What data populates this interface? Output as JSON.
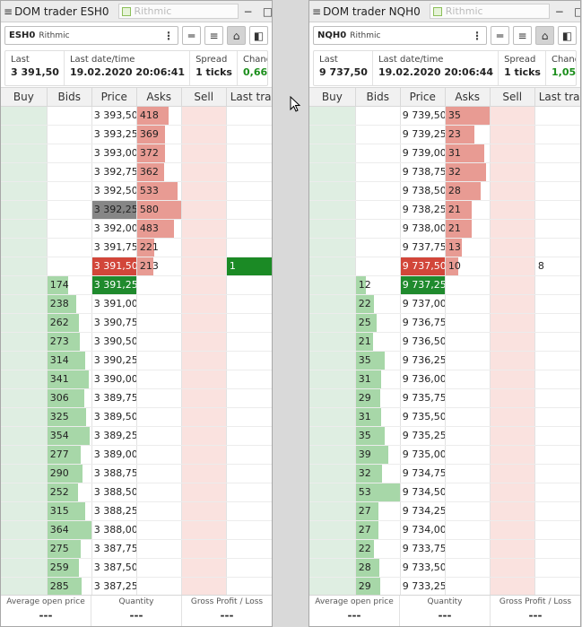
{
  "windows": [
    {
      "title": "DOM trader ESH0",
      "tab_label": "Rithmic",
      "symbol": "ESH0",
      "connection": "Rithmic",
      "info": [
        {
          "label": "Last",
          "value": "3 391,50"
        },
        {
          "label": "Last date/time",
          "value": "19.02.2020 20:06:41"
        },
        {
          "label": "Spread",
          "value": "1 ticks"
        },
        {
          "label": "Change, %",
          "value": "0,66"
        }
      ],
      "headers": [
        "Buy",
        "Bids",
        "Price",
        "Asks",
        "Sell",
        "Last trade"
      ],
      "rows": [
        {
          "price": "3 393,50",
          "ask": "418",
          "askv": 418
        },
        {
          "price": "3 393,25",
          "ask": "369",
          "askv": 369
        },
        {
          "price": "3 393,00",
          "ask": "372",
          "askv": 372
        },
        {
          "price": "3 392,75",
          "ask": "362",
          "askv": 362
        },
        {
          "price": "3 392,50",
          "ask": "533",
          "askv": 533
        },
        {
          "price": "3 392,25",
          "ask": "580",
          "askv": 580,
          "sel": true
        },
        {
          "price": "3 392,00",
          "ask": "483",
          "askv": 483
        },
        {
          "price": "3 391,75",
          "ask": "221",
          "askv": 221
        },
        {
          "price": "3 391,50",
          "ask": "213",
          "askv": 213,
          "best": "ask",
          "last": "1"
        },
        {
          "price": "3 391,25",
          "bid": "174",
          "bidv": 174,
          "best": "bid"
        },
        {
          "price": "3 391,00",
          "bid": "238",
          "bidv": 238
        },
        {
          "price": "3 390,75",
          "bid": "262",
          "bidv": 262
        },
        {
          "price": "3 390,50",
          "bid": "273",
          "bidv": 273
        },
        {
          "price": "3 390,25",
          "bid": "314",
          "bidv": 314
        },
        {
          "price": "3 390,00",
          "bid": "341",
          "bidv": 341
        },
        {
          "price": "3 389,75",
          "bid": "306",
          "bidv": 306
        },
        {
          "price": "3 389,50",
          "bid": "325",
          "bidv": 325
        },
        {
          "price": "3 389,25",
          "bid": "354",
          "bidv": 354
        },
        {
          "price": "3 389,00",
          "bid": "277",
          "bidv": 277
        },
        {
          "price": "3 388,75",
          "bid": "290",
          "bidv": 290
        },
        {
          "price": "3 388,50",
          "bid": "252",
          "bidv": 252
        },
        {
          "price": "3 388,25",
          "bid": "315",
          "bidv": 315
        },
        {
          "price": "3 388,00",
          "bid": "364",
          "bidv": 364
        },
        {
          "price": "3 387,75",
          "bid": "275",
          "bidv": 275
        },
        {
          "price": "3 387,50",
          "bid": "259",
          "bidv": 259
        },
        {
          "price": "3 387,25",
          "bid": "285",
          "bidv": 285
        }
      ],
      "footer": [
        {
          "label": "Average open price",
          "value": "---"
        },
        {
          "label": "Quantity",
          "value": "---"
        },
        {
          "label": "Gross Profit / Loss",
          "value": "---"
        }
      ]
    },
    {
      "title": "DOM trader NQH0",
      "tab_label": "Rithmic",
      "symbol": "NQH0",
      "connection": "Rithmic",
      "info": [
        {
          "label": "Last",
          "value": "9 737,50"
        },
        {
          "label": "Last date/time",
          "value": "19.02.2020 20:06:44"
        },
        {
          "label": "Spread",
          "value": "1 ticks"
        },
        {
          "label": "Change, %",
          "value": "1,05"
        }
      ],
      "headers": [
        "Buy",
        "Bids",
        "Price",
        "Asks",
        "Sell",
        "Last trade"
      ],
      "rows": [
        {
          "price": "9 739,50",
          "ask": "35",
          "askv": 35
        },
        {
          "price": "9 739,25",
          "ask": "23",
          "askv": 23
        },
        {
          "price": "9 739,00",
          "ask": "31",
          "askv": 31
        },
        {
          "price": "9 738,75",
          "ask": "32",
          "askv": 32
        },
        {
          "price": "9 738,50",
          "ask": "28",
          "askv": 28
        },
        {
          "price": "9 738,25",
          "ask": "21",
          "askv": 21
        },
        {
          "price": "9 738,00",
          "ask": "21",
          "askv": 21
        },
        {
          "price": "9 737,75",
          "ask": "13",
          "askv": 13
        },
        {
          "price": "9 737,50",
          "ask": "10",
          "askv": 10,
          "best": "ask",
          "last": "8"
        },
        {
          "price": "9 737,25",
          "bid": "12",
          "bidv": 12,
          "best": "bid"
        },
        {
          "price": "9 737,00",
          "bid": "22",
          "bidv": 22
        },
        {
          "price": "9 736,75",
          "bid": "25",
          "bidv": 25
        },
        {
          "price": "9 736,50",
          "bid": "21",
          "bidv": 21
        },
        {
          "price": "9 736,25",
          "bid": "35",
          "bidv": 35
        },
        {
          "price": "9 736,00",
          "bid": "31",
          "bidv": 31
        },
        {
          "price": "9 735,75",
          "bid": "29",
          "bidv": 29
        },
        {
          "price": "9 735,50",
          "bid": "31",
          "bidv": 31
        },
        {
          "price": "9 735,25",
          "bid": "35",
          "bidv": 35
        },
        {
          "price": "9 735,00",
          "bid": "39",
          "bidv": 39
        },
        {
          "price": "9 734,75",
          "bid": "32",
          "bidv": 32
        },
        {
          "price": "9 734,50",
          "bid": "53",
          "bidv": 53
        },
        {
          "price": "9 734,25",
          "bid": "27",
          "bidv": 27
        },
        {
          "price": "9 734,00",
          "bid": "27",
          "bidv": 27
        },
        {
          "price": "9 733,75",
          "bid": "22",
          "bidv": 22
        },
        {
          "price": "9 733,50",
          "bid": "28",
          "bidv": 28
        },
        {
          "price": "9 733,25",
          "bid": "29",
          "bidv": 29
        }
      ],
      "footer": [
        {
          "label": "Average open price",
          "value": "---"
        },
        {
          "label": "Quantity",
          "value": "---"
        },
        {
          "label": "Gross Profit / Loss",
          "value": "---"
        }
      ]
    }
  ],
  "colors": {
    "buy_column": "#dfeee2",
    "sell_column": "#fae2df",
    "best_bid": "#1f8a2d",
    "best_ask": "#d2463a",
    "ask_bar": "#e89b93",
    "bid_bar": "#a7d7a8",
    "positive_change": "#1b8e1b"
  }
}
